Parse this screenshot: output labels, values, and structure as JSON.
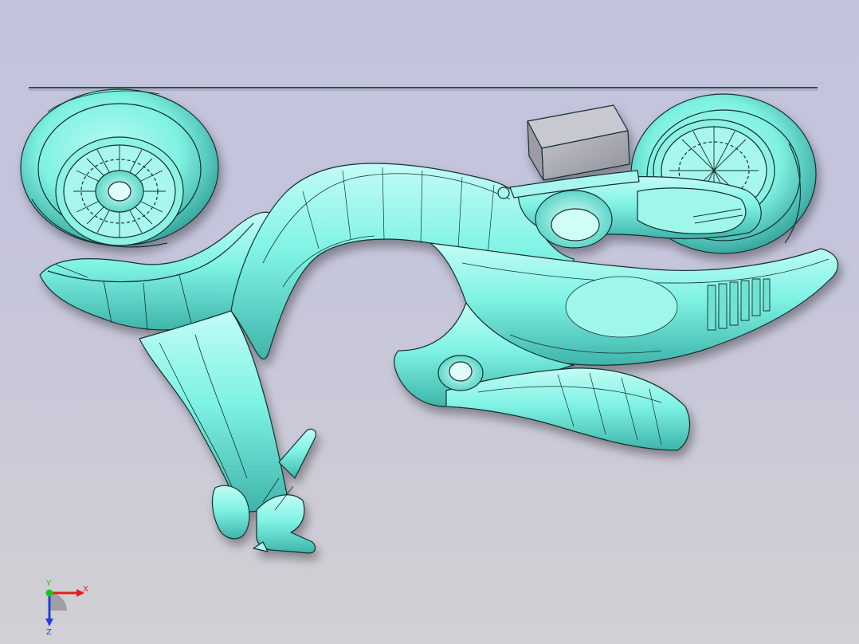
{
  "viewport": {
    "background_top": "#c3c3de",
    "background_bottom": "#d2d0d4"
  },
  "model": {
    "body_color": "#7ff3e4",
    "body_light": "#bffcf4",
    "body_dark": "#3fb0a8",
    "edge_color": "#14302e",
    "box_color": "#a9a9b1"
  },
  "triad": {
    "x_label": "X",
    "y_label": "Y",
    "z_label": "Z",
    "x_color": "#e02020",
    "y_color": "#20c020",
    "z_color": "#2040e0"
  }
}
